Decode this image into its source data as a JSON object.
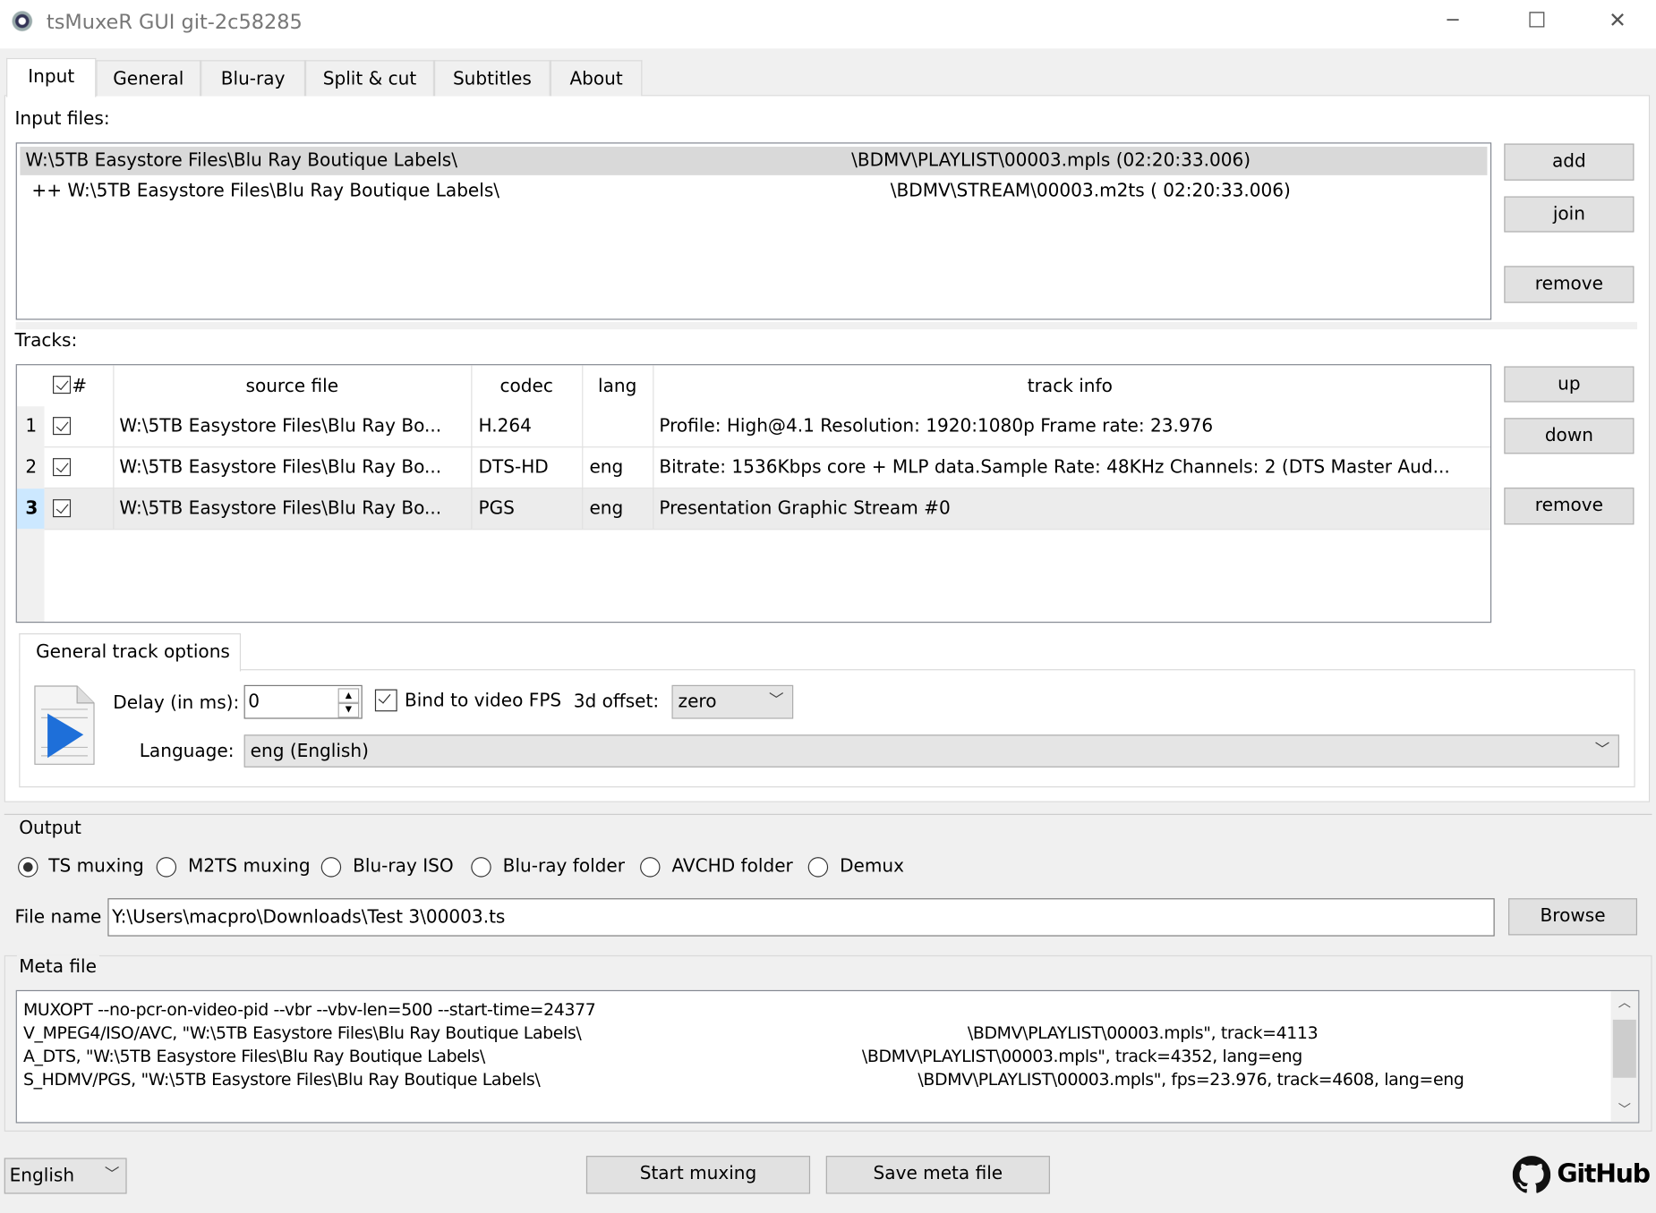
{
  "window": {
    "title": "tsMuxeR GUI git-2c58285",
    "minimize": "─",
    "maximize": "☐",
    "close": "✕"
  },
  "tabs": [
    "Input",
    "General",
    "Blu-ray",
    "Split & cut",
    "Subtitles",
    "About"
  ],
  "input_files": {
    "label": "Input files:",
    "rows": [
      {
        "left": "W:\\5TB Easystore Files\\Blu Ray Boutique Labels\\",
        "right": "\\BDMV\\PLAYLIST\\00003.mpls (02:20:33.006)"
      },
      {
        "left": "++ W:\\5TB Easystore Files\\Blu Ray Boutique Labels\\",
        "right": "\\BDMV\\STREAM\\00003.m2ts ( 02:20:33.006)"
      }
    ],
    "buttons": {
      "add": "add",
      "join": "join",
      "remove": "remove"
    }
  },
  "tracks": {
    "label": "Tracks:",
    "headers": {
      "num": "#",
      "source": "source file",
      "codec": "codec",
      "lang": "lang",
      "info": "track info"
    },
    "rows": [
      {
        "n": "1",
        "source": "W:\\5TB Easystore Files\\Blu Ray Bo...",
        "codec": "H.264",
        "lang": "",
        "info": "Profile: High@4.1  Resolution: 1920:1080p  Frame rate: 23.976"
      },
      {
        "n": "2",
        "source": "W:\\5TB Easystore Files\\Blu Ray Bo...",
        "codec": "DTS-HD",
        "lang": "eng",
        "info": "Bitrate: 1536Kbps  core + MLP data.Sample Rate: 48KHz  Channels: 2 (DTS Master Aud..."
      },
      {
        "n": "3",
        "source": "W:\\5TB Easystore Files\\Blu Ray Bo...",
        "codec": "PGS",
        "lang": "eng",
        "info": "Presentation Graphic Stream #0"
      }
    ],
    "buttons": {
      "up": "up",
      "down": "down",
      "remove": "remove"
    }
  },
  "track_options": {
    "tab": "General track options",
    "delay_label": "Delay (in ms):",
    "delay_value": "0",
    "bind_fps": "Bind to video FPS",
    "offset_label": "3d offset:",
    "offset_value": "zero",
    "language_label": "Language:",
    "language_value": "eng (English)"
  },
  "output": {
    "label": "Output",
    "modes": [
      "TS muxing",
      "M2TS muxing",
      "Blu-ray ISO",
      "Blu-ray folder",
      "AVCHD folder",
      "Demux"
    ],
    "selected": "TS muxing",
    "file_label": "File name",
    "file_value": "Y:\\Users\\macpro\\Downloads\\Test 3\\00003.ts",
    "browse": "Browse"
  },
  "meta": {
    "label": "Meta file",
    "lines": [
      [
        "MUXOPT --no-pcr-on-video-pid --vbr  --vbv-len=500 --start-time=24377",
        ""
      ],
      [
        "V_MPEG4/ISO/AVC, \"W:\\5TB Easystore Files\\Blu Ray Boutique Labels\\",
        "\\BDMV\\PLAYLIST\\00003.mpls\", track=4113"
      ],
      [
        "A_DTS, \"W:\\5TB Easystore Files\\Blu Ray Boutique Labels\\",
        "\\BDMV\\PLAYLIST\\00003.mpls\", track=4352, lang=eng"
      ],
      [
        "S_HDMV/PGS, \"W:\\5TB Easystore Files\\Blu Ray Boutique Labels\\",
        "\\BDMV\\PLAYLIST\\00003.mpls\", fps=23.976, track=4608, lang=eng"
      ]
    ]
  },
  "footer": {
    "language": "English",
    "start": "Start muxing",
    "save": "Save meta file",
    "github": "GitHub"
  }
}
